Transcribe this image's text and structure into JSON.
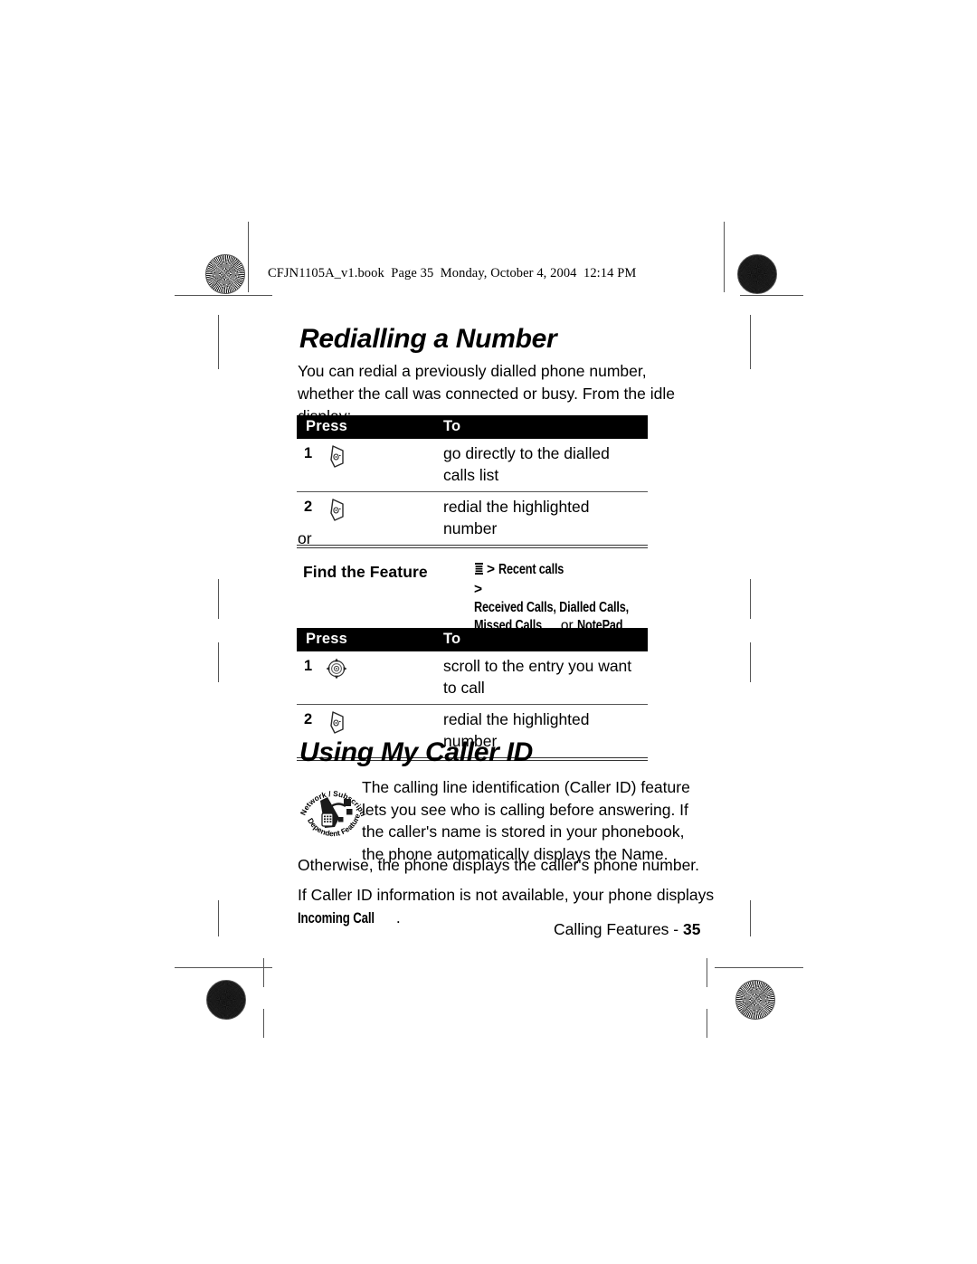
{
  "document": {
    "file_header": "CFJN1105A_v1.book  Page 35  Monday, October 4, 2004  12:14 PM",
    "footer_label": "Calling Features - ",
    "footer_page": "35"
  },
  "sections": [
    {
      "title": "Redialling a Number",
      "intro": "You can redial a previously dialled phone number, whether the call was connected or busy. From the idle display:"
    },
    {
      "title": "Using My Caller ID"
    }
  ],
  "table_1": {
    "headers": {
      "press": "Press",
      "to": "To"
    },
    "rows": [
      {
        "num": "1",
        "icon": "send-key-icon",
        "to": "go directly to the dialled calls list"
      },
      {
        "num": "2",
        "icon": "send-key-icon",
        "to": "redial the highlighted number"
      }
    ]
  },
  "table_2": {
    "headers": {
      "press": "Press",
      "to": "To"
    },
    "rows": [
      {
        "num": "1",
        "icon": "navigation-key-icon",
        "to": "scroll to the entry you want to call"
      },
      {
        "num": "2",
        "icon": "send-key-icon",
        "to": "redial the highlighted number"
      }
    ]
  },
  "connector": {
    "or": "or"
  },
  "find_the_feature": {
    "label": "Find the Feature",
    "menu_icon": "menu-icon",
    "separator": ">",
    "line1": "Recent calls",
    "line2": "Received Calls, Dialled Calls,",
    "line3_a": "Missed Calls",
    "line3_or": "or",
    "line3_b": "NotePad"
  },
  "caller_id": {
    "badge": {
      "top_arc": "Network / Subscription",
      "bottom_arc": "Dependent  Feature",
      "icon": "phone-feature-icon"
    },
    "paragraph_1": "The calling line identification (Caller ID) feature lets you see who is calling before answering. If the caller's name is stored in your phonebook, the phone automatically displays the Name.",
    "paragraph_2": "Otherwise, the phone displays the caller's phone number.",
    "paragraph_3": "If Caller ID information is not available, your phone displays ",
    "display_text": "Incoming Call",
    "paragraph_3_end": "."
  },
  "print_marks": {
    "registration": "registration-crosshair-mark",
    "starburst": "starburst-density-mark",
    "trim": "trim-line"
  }
}
